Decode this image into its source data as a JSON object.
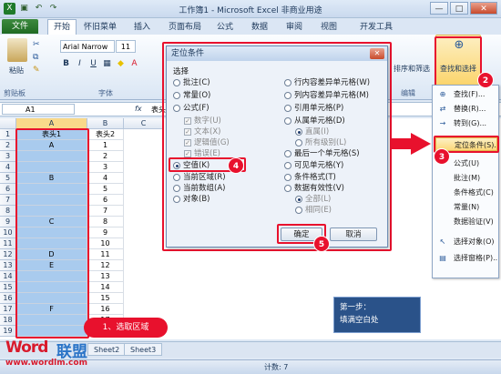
{
  "window": {
    "title": "工作簿1 - Microsoft Excel 非商业用途",
    "min": "—",
    "max": "□",
    "close": "✕"
  },
  "tabs": {
    "file": "文件",
    "items": [
      "开始",
      "怀旧菜单",
      "插入",
      "页面布局",
      "公式",
      "数据",
      "审阅",
      "视图",
      "开发工具"
    ]
  },
  "ribbon": {
    "paste_label": "粘贴",
    "clipboard_group": "剪贴板",
    "font_name": "Arial Narrow",
    "font_size": "11",
    "font_group": "字体",
    "sort_filter": "排序和筛选",
    "find_select": "查找和选择",
    "edit_group": "编辑"
  },
  "formula_bar": {
    "name_box": "A1",
    "fx": "fx",
    "content": "表头1"
  },
  "sheet": {
    "col_headers": [
      "A",
      "B",
      "C"
    ],
    "rows": [
      {
        "n": "1",
        "a": "表头1",
        "b": "表头2"
      },
      {
        "n": "2",
        "a": "A",
        "b": "1"
      },
      {
        "n": "3",
        "a": "",
        "b": "2"
      },
      {
        "n": "4",
        "a": "",
        "b": "3"
      },
      {
        "n": "5",
        "a": "B",
        "b": "4"
      },
      {
        "n": "6",
        "a": "",
        "b": "5"
      },
      {
        "n": "7",
        "a": "",
        "b": "6"
      },
      {
        "n": "8",
        "a": "",
        "b": "7"
      },
      {
        "n": "9",
        "a": "C",
        "b": "8"
      },
      {
        "n": "10",
        "a": "",
        "b": "9"
      },
      {
        "n": "11",
        "a": "",
        "b": "10"
      },
      {
        "n": "12",
        "a": "D",
        "b": "11"
      },
      {
        "n": "13",
        "a": "E",
        "b": "12"
      },
      {
        "n": "14",
        "a": "",
        "b": "13"
      },
      {
        "n": "15",
        "a": "",
        "b": "14"
      },
      {
        "n": "16",
        "a": "",
        "b": "15"
      },
      {
        "n": "17",
        "a": "F",
        "b": "16"
      },
      {
        "n": "18",
        "a": "",
        "b": "17"
      },
      {
        "n": "19",
        "a": "",
        "b": "18"
      }
    ],
    "sheet_tabs": [
      "Sheet2",
      "Sheet3"
    ],
    "status": "计数: 7"
  },
  "dialog": {
    "title": "定位条件",
    "section": "选择",
    "left_options": [
      {
        "label": "批注(C)",
        "type": "radio",
        "checked": false,
        "enabled": true
      },
      {
        "label": "常量(O)",
        "type": "radio",
        "checked": false,
        "enabled": true
      },
      {
        "label": "公式(F)",
        "type": "radio",
        "checked": false,
        "enabled": true
      },
      {
        "label": "数字(U)",
        "type": "check",
        "checked": true,
        "enabled": false
      },
      {
        "label": "文本(X)",
        "type": "check",
        "checked": true,
        "enabled": false
      },
      {
        "label": "逻辑值(G)",
        "type": "check",
        "checked": true,
        "enabled": false
      },
      {
        "label": "错误(E)",
        "type": "check",
        "checked": true,
        "enabled": false
      },
      {
        "label": "空值(K)",
        "type": "radio",
        "checked": true,
        "enabled": true
      },
      {
        "label": "当前区域(R)",
        "type": "radio",
        "checked": false,
        "enabled": true
      },
      {
        "label": "当前数组(A)",
        "type": "radio",
        "checked": false,
        "enabled": true
      },
      {
        "label": "对象(B)",
        "type": "radio",
        "checked": false,
        "enabled": true
      }
    ],
    "right_options": [
      {
        "label": "行内容差异单元格(W)",
        "type": "radio",
        "checked": false,
        "enabled": true
      },
      {
        "label": "列内容差异单元格(M)",
        "type": "radio",
        "checked": false,
        "enabled": true
      },
      {
        "label": "引用单元格(P)",
        "type": "radio",
        "checked": false,
        "enabled": true
      },
      {
        "label": "从属单元格(D)",
        "type": "radio",
        "checked": false,
        "enabled": true
      },
      {
        "label": "直属(I)",
        "type": "radio",
        "checked": true,
        "enabled": false
      },
      {
        "label": "所有级别(L)",
        "type": "radio",
        "checked": false,
        "enabled": false
      },
      {
        "label": "最后一个单元格(S)",
        "type": "radio",
        "checked": false,
        "enabled": true
      },
      {
        "label": "可见单元格(Y)",
        "type": "radio",
        "checked": false,
        "enabled": true
      },
      {
        "label": "条件格式(T)",
        "type": "radio",
        "checked": false,
        "enabled": true
      },
      {
        "label": "数据有效性(V)",
        "type": "radio",
        "checked": false,
        "enabled": true
      },
      {
        "label": "全部(L)",
        "type": "radio",
        "checked": true,
        "enabled": false
      },
      {
        "label": "相同(E)",
        "type": "radio",
        "checked": false,
        "enabled": false
      }
    ],
    "ok": "确定",
    "cancel": "取消"
  },
  "menu": {
    "items": [
      {
        "label": "查找(F)...",
        "icon": "binoculars-icon"
      },
      {
        "label": "替换(R)...",
        "icon": "replace-icon"
      },
      {
        "label": "转到(G)...",
        "icon": "goto-arrow-icon"
      },
      {
        "label": "定位条件(S)...",
        "icon": "",
        "highlight": true
      },
      {
        "label": "公式(U)",
        "icon": ""
      },
      {
        "label": "批注(M)",
        "icon": ""
      },
      {
        "label": "条件格式(C)",
        "icon": ""
      },
      {
        "label": "常量(N)",
        "icon": ""
      },
      {
        "label": "数据验证(V)",
        "icon": ""
      },
      {
        "label": "选择对象(O)",
        "icon": "select-object-icon"
      },
      {
        "label": "选择窗格(P)...",
        "icon": "selection-pane-icon"
      }
    ]
  },
  "annotations": {
    "step1": "1、选取区域",
    "n2": "2",
    "n3": "3",
    "n4": "4",
    "n5": "5",
    "callout_line1": "第一步：",
    "callout_line2": "填满空白处",
    "colors": {
      "accent_red": "#e8112d",
      "selection_blue": "#a9cbee",
      "callout_navy": "#2a5289"
    }
  },
  "watermark": {
    "brand_a": "Word",
    "brand_b": "联盟",
    "url": "www.wordlm.com"
  }
}
